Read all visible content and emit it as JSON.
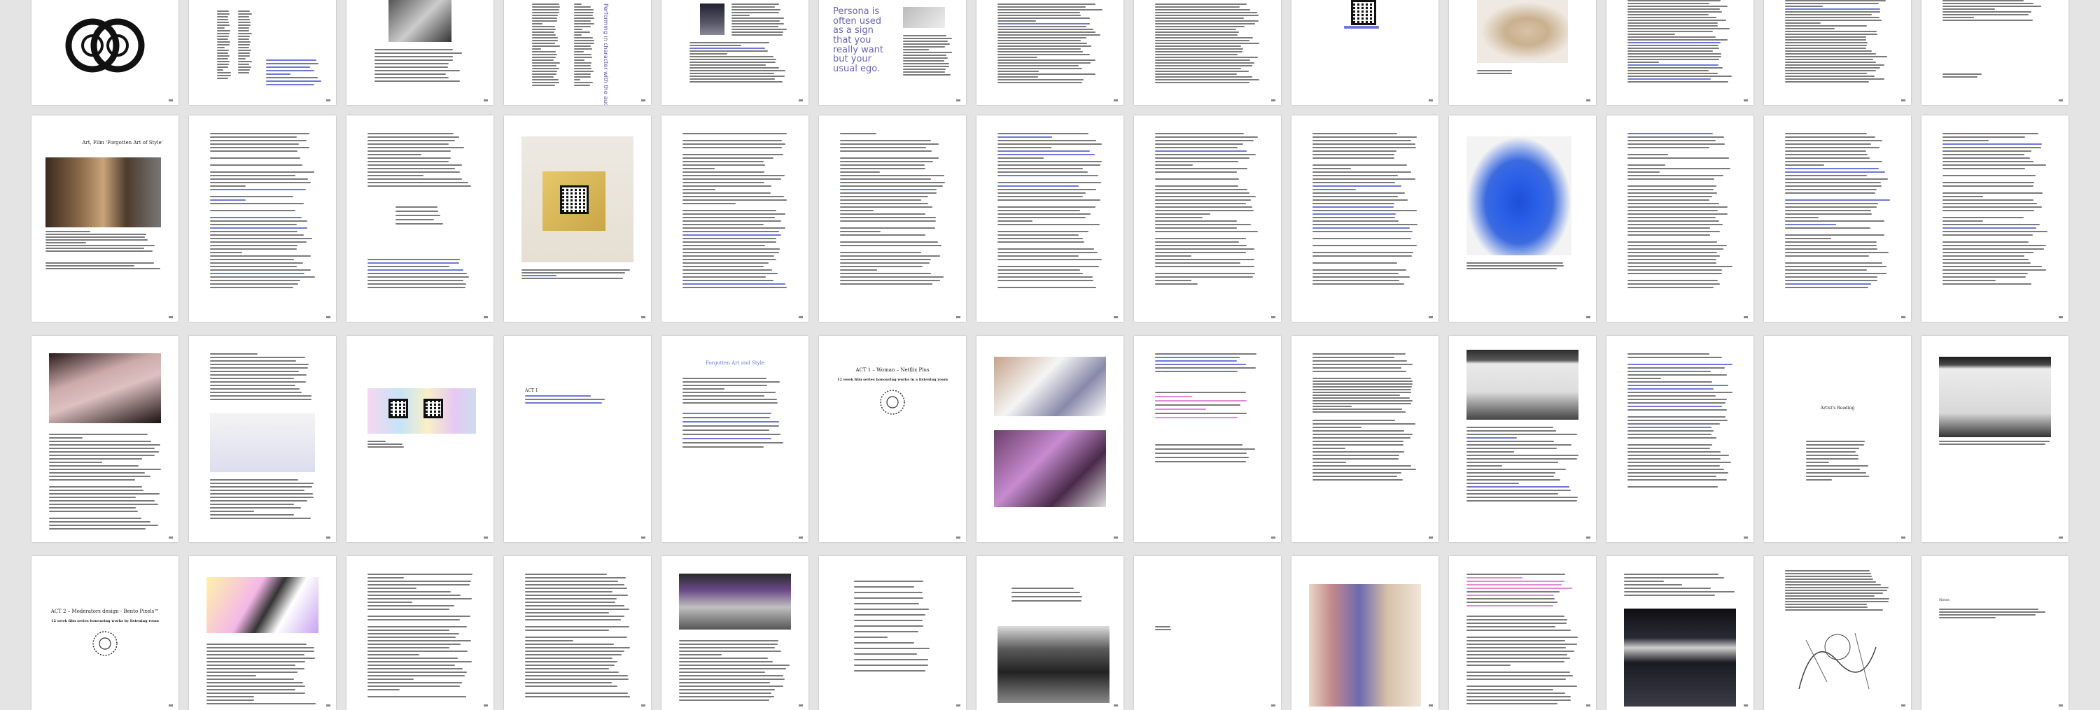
{
  "view": {
    "mode": "page-thumbnail-grid",
    "rows": 4,
    "columns": 13,
    "colors": {
      "background": "#e4e4e4",
      "page": "#ffffff",
      "text": "#7a7a7a",
      "link_highlight": "#6d78d8",
      "accent_purple": "#6b63b5"
    }
  },
  "pages": {
    "p1_5": {
      "text": "Persona is often used as a sign that you really want but your usual ego."
    },
    "p1_3": {
      "text": "Performing in character with the audience"
    },
    "p2_1": {
      "title": "Art, Film 'Forgotten Art of Style'"
    },
    "p3_9": {
      "title": "ACT 1 – Woman – Netflix Plus",
      "subtitle": "12 week film series honouring works in a listening room"
    },
    "p3_6": {
      "title": "Forgotten Art and Style"
    },
    "p3_4": {
      "title": "ACT 1"
    },
    "p4_1": {
      "title": "ACT 2 – Moderators design - Bento Pixels™",
      "subtitle": "12 week film series honouring works by listening room"
    },
    "p3_11": {
      "title": "Artist's Reading"
    },
    "p4_13": {
      "title": "Notes"
    }
  }
}
